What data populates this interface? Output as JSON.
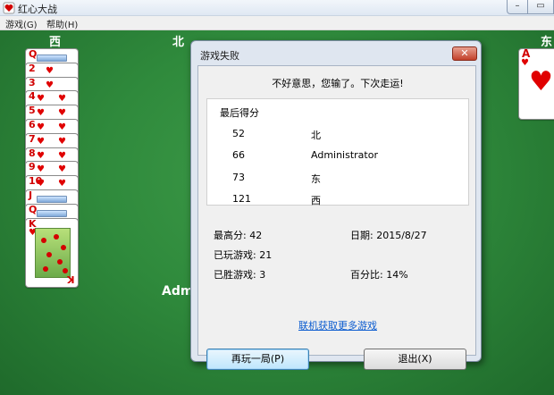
{
  "window": {
    "title": "红心大战",
    "min": "–",
    "max": "▭"
  },
  "menu": {
    "items": [
      "游戏(G)",
      "帮助(H)"
    ]
  },
  "seats": {
    "west": "西",
    "north": "北",
    "east": "东"
  },
  "player_name_partial": "Adm",
  "west_hand": {
    "suit_symbol": "♥",
    "ranks": [
      "Q",
      "2",
      "3",
      "4",
      "5",
      "6",
      "7",
      "8",
      "9",
      "10",
      "J",
      "Q",
      "K"
    ]
  },
  "east_card": {
    "rank": "A",
    "suit_symbol": "♥"
  },
  "dialog": {
    "title": "游戏失败",
    "close": "✕",
    "message": "不好意思，您输了。下次走运!",
    "scores_title": "最后得分",
    "scores": [
      {
        "score": "52",
        "name": "北"
      },
      {
        "score": "66",
        "name": "Administrator"
      },
      {
        "score": "73",
        "name": "东"
      },
      {
        "score": "121",
        "name": "西"
      }
    ],
    "high_score": "最高分: 42",
    "date": "日期: 2015/8/27",
    "games_played": "已玩游戏: 21",
    "games_won": "已胜游戏: 3",
    "percent": "百分比: 14%",
    "online_link": "联机获取更多游戏",
    "play_again": "再玩一局(P)",
    "exit": "退出(X)"
  },
  "colors": {
    "felt": "#2f8a3c",
    "heart": "#e00000",
    "link": "#0a5bcf"
  }
}
